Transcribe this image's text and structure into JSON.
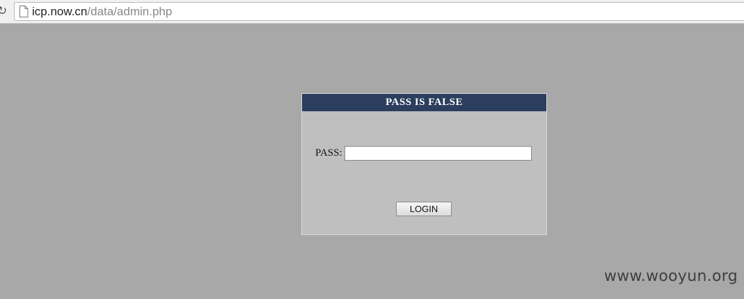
{
  "browser": {
    "url_host": "icp.now.cn",
    "url_path": "/data/admin.php",
    "reload_icon": "reload-icon",
    "page_icon": "page-icon"
  },
  "login": {
    "title": "PASS IS FALSE",
    "pass_label": "PASS:",
    "pass_value": "",
    "login_button": "LOGIN"
  },
  "watermark": "www.wooyun.org",
  "colors": {
    "page_background": "#a8a8a8",
    "panel_background": "#bfbfbf",
    "header_background": "#2b3e5e",
    "header_text": "#ffffff"
  }
}
